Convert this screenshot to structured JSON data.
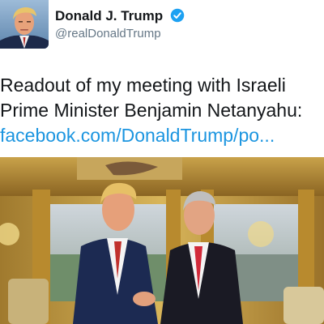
{
  "tweet": {
    "author": {
      "name": "Donald J. Trump",
      "handle": "@realDonaldTrump",
      "verified": true,
      "verified_color": "#1da1f2"
    },
    "text_lines": [
      "Readout of my meeting with Israeli",
      "Prime Minister Benjamin Netanyahu:"
    ],
    "link": "facebook.com/DonaldTrump/po...",
    "link_color": "#1b95e0",
    "icons": {
      "verified": "verified-badge-icon"
    }
  }
}
